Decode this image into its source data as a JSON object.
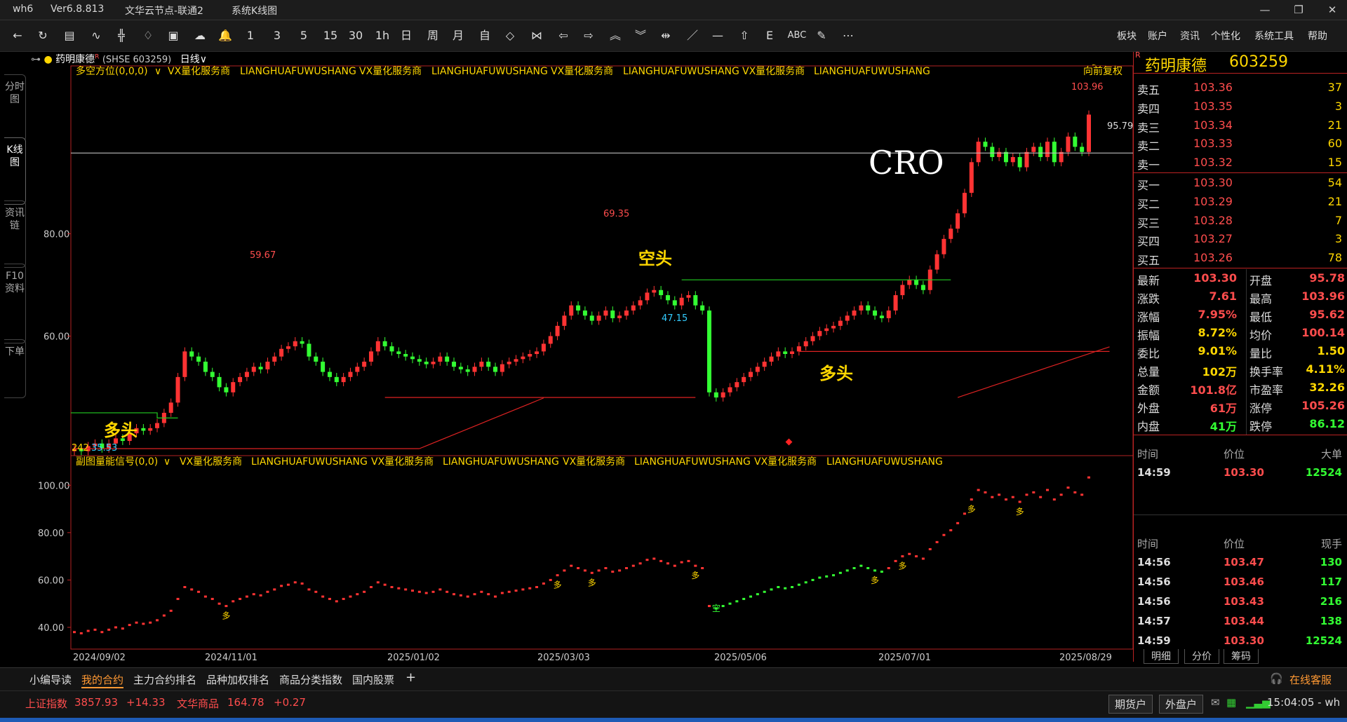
{
  "window": {
    "app": "wh6",
    "version": "Ver6.8.813",
    "server": "文华云节点-联通2",
    "view": "系统K线图"
  },
  "menu": [
    "板块",
    "账户",
    "资讯",
    "个性化",
    "系统工具",
    "帮助"
  ],
  "toolbar": {
    "periods": [
      "1",
      "3",
      "5",
      "15",
      "30",
      "1h",
      "日",
      "周",
      "月",
      "自"
    ],
    "text_tool": "ABC"
  },
  "left_tabs": [
    "分时图",
    "K线图",
    "资讯链",
    "F10资料",
    "下单"
  ],
  "chart_header": {
    "symbol": "药明康德",
    "symbol_mark": "R",
    "code": "(SHSE 603259)",
    "period": "日线",
    "period_caret": "∨",
    "main_indicator": "多空方位(0,0,0)",
    "sub_indicator": "副图量能信号(0,0)",
    "banner_vx": "VX量化服务商",
    "banner_en": "LIANGHUAFUWUSHANG",
    "restore": "向前复权"
  },
  "annotations": {
    "cro": "CRO",
    "kongtou": "空头",
    "duotou": "多头",
    "duo": "多",
    "kong": "空",
    "high_label": "103.96",
    "ref_line": "95.79",
    "peak1": "59.67",
    "peak2": "69.35",
    "low1": "47.15",
    "low0": "35.53",
    "low0_prefix": "242"
  },
  "chart_data": {
    "type": "candlestick",
    "x_ticks": [
      "2024/09/02",
      "2024/11/01",
      "2025/01/02",
      "2025/03/03",
      "2025/05/06",
      "2025/07/01",
      "2025/08/29"
    ],
    "main_y_ticks": [
      "80.00",
      "60.00"
    ],
    "sub_y_ticks": [
      "100.00",
      "80.00",
      "60.00",
      "40.00"
    ],
    "ylim_main": [
      38,
      112
    ],
    "ylim_sub": [
      32,
      106
    ],
    "close": [
      38,
      37.5,
      38.5,
      39,
      38,
      39,
      40,
      39.5,
      41,
      42,
      41.5,
      42,
      43,
      45,
      47,
      52,
      57,
      56,
      55,
      53,
      52,
      50,
      49,
      51,
      52,
      53,
      54,
      53.5,
      55,
      56,
      57.5,
      58,
      59,
      58.5,
      56,
      55,
      53,
      52,
      51,
      52,
      53,
      54,
      55,
      57,
      59,
      58,
      57,
      56.5,
      56,
      55.5,
      55,
      54.5,
      55,
      56,
      55,
      54,
      53.5,
      53,
      54,
      55,
      54,
      53,
      54.5,
      55,
      55.5,
      56,
      56.5,
      57,
      58.5,
      60,
      62,
      64,
      66,
      65,
      64,
      63,
      64,
      65,
      63.5,
      64,
      65,
      66,
      67,
      68.5,
      69,
      68,
      67,
      66,
      67.5,
      68,
      66,
      65,
      49,
      48,
      49,
      50,
      51,
      52,
      53,
      54,
      55,
      56,
      57,
      56.5,
      57,
      58,
      59,
      60,
      61,
      61.5,
      62,
      63,
      64,
      65,
      66,
      65,
      64,
      63.5,
      65,
      68,
      70,
      71,
      70,
      69,
      73,
      76,
      79,
      81,
      84,
      88,
      94,
      98,
      97,
      95,
      96,
      94,
      95,
      93,
      96,
      97,
      95,
      98,
      94,
      96,
      99,
      97,
      96,
      103.3
    ],
    "supports": [
      {
        "from": 0,
        "to": 50,
        "value": 38
      },
      {
        "from": 45,
        "to": 90,
        "value": 48
      },
      {
        "from": 105,
        "to": 150,
        "value": 57
      }
    ],
    "resistance_ref": 95.79
  },
  "quote": {
    "name": "药明康德",
    "code": "603259",
    "mark": "R",
    "asks": [
      {
        "label": "卖五",
        "price": "103.36",
        "vol": "37"
      },
      {
        "label": "卖四",
        "price": "103.35",
        "vol": "3"
      },
      {
        "label": "卖三",
        "price": "103.34",
        "vol": "21"
      },
      {
        "label": "卖二",
        "price": "103.33",
        "vol": "60"
      },
      {
        "label": "卖一",
        "price": "103.32",
        "vol": "15"
      }
    ],
    "bids": [
      {
        "label": "买一",
        "price": "103.30",
        "vol": "54"
      },
      {
        "label": "买二",
        "price": "103.29",
        "vol": "21"
      },
      {
        "label": "买三",
        "price": "103.28",
        "vol": "7"
      },
      {
        "label": "买四",
        "price": "103.27",
        "vol": "3"
      },
      {
        "label": "买五",
        "price": "103.26",
        "vol": "78"
      }
    ],
    "stats": [
      {
        "l1": "最新",
        "v1": "103.30",
        "c1": "#ff4d4d",
        "l2": "开盘",
        "v2": "95.78",
        "c2": "#ff4d4d"
      },
      {
        "l1": "涨跌",
        "v1": "7.61",
        "c1": "#ff4d4d",
        "l2": "最高",
        "v2": "103.96",
        "c2": "#ff4d4d"
      },
      {
        "l1": "涨幅",
        "v1": "7.95%",
        "c1": "#ff4d4d",
        "l2": "最低",
        "v2": "95.62",
        "c2": "#ff4d4d"
      },
      {
        "l1": "振幅",
        "v1": "8.72%",
        "c1": "#ffd700",
        "l2": "均价",
        "v2": "100.14",
        "c2": "#ff4d4d"
      },
      {
        "l1": "委比",
        "v1": "9.01%",
        "c1": "#ffd700",
        "l2": "量比",
        "v2": "1.50",
        "c2": "#ffd700"
      },
      {
        "l1": "总量",
        "v1": "102万",
        "c1": "#ffd700",
        "l2": "换手率",
        "v2": "4.11%",
        "c2": "#ffd700"
      },
      {
        "l1": "金额",
        "v1": "101.8亿",
        "c1": "#ff4d4d",
        "l2": "市盈率",
        "v2": "32.26",
        "c2": "#ffd700"
      },
      {
        "l1": "外盘",
        "v1": "61万",
        "c1": "#ff4d4d",
        "l2": "涨停",
        "v2": "105.26",
        "c2": "#ff4d4d"
      },
      {
        "l1": "内盘",
        "v1": "41万",
        "c1": "#33ff33",
        "l2": "跌停",
        "v2": "86.12",
        "c2": "#33ff33"
      }
    ],
    "bigorder_header": [
      "时间",
      "价位",
      "大单"
    ],
    "bigorders": [
      {
        "time": "14:59",
        "price": "103.30",
        "vol": "12524"
      }
    ],
    "ticks_header": [
      "时间",
      "价位",
      "现手"
    ],
    "ticks": [
      {
        "time": "14:56",
        "price": "103.47",
        "vol": "130"
      },
      {
        "time": "14:56",
        "price": "103.46",
        "vol": "117"
      },
      {
        "time": "14:56",
        "price": "103.43",
        "vol": "216"
      },
      {
        "time": "14:57",
        "price": "103.44",
        "vol": "138"
      },
      {
        "time": "14:59",
        "price": "103.30",
        "vol": "12524"
      }
    ],
    "bottom_tabs": [
      "明细",
      "分价",
      "筹码"
    ]
  },
  "bottom_tabs": [
    "小编导读",
    "我的合约",
    "主力合约排名",
    "品种加权排名",
    "商品分类指数",
    "国内股票"
  ],
  "add_tab": "+",
  "service": "在线客服",
  "status": {
    "idx1_name": "上证指数",
    "idx1_val": "3857.93",
    "idx1_chg": "+14.33",
    "idx2_name": "文华商品",
    "idx2_val": "164.78",
    "idx2_chg": "+0.27",
    "btn1": "期货户",
    "btn2": "外盘户",
    "time": "15:04:05 - wh"
  },
  "colors": {
    "up": "#ff3333",
    "down": "#33ff33",
    "accent": "#ffd700",
    "border": "#b22222"
  }
}
